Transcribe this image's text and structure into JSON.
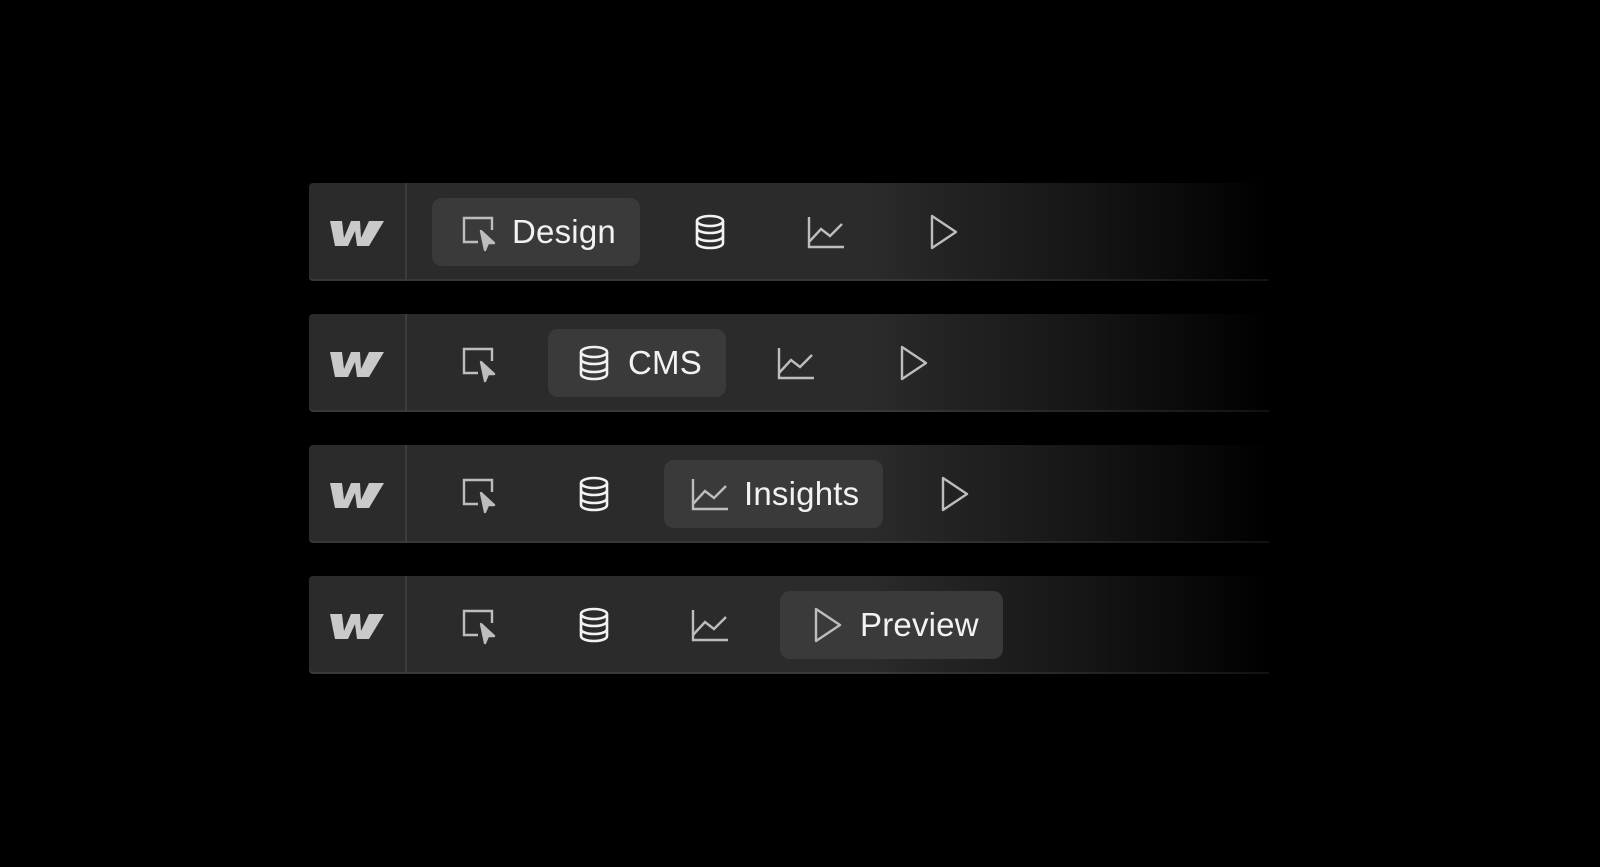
{
  "colors": {
    "background": "#000000",
    "bar": "#2b2b2b",
    "active_item": "#3a3a3a",
    "text": "#f2f2f2",
    "icon": "#bdbdbd"
  },
  "bars": [
    {
      "active": "design",
      "items": [
        {
          "key": "design",
          "icon": "cursor-select-icon",
          "label": "Design"
        },
        {
          "key": "cms",
          "icon": "database-icon",
          "label": ""
        },
        {
          "key": "insights",
          "icon": "line-chart-icon",
          "label": ""
        },
        {
          "key": "preview",
          "icon": "play-icon",
          "label": ""
        }
      ]
    },
    {
      "active": "cms",
      "items": [
        {
          "key": "design",
          "icon": "cursor-select-icon",
          "label": ""
        },
        {
          "key": "cms",
          "icon": "database-icon",
          "label": "CMS"
        },
        {
          "key": "insights",
          "icon": "line-chart-icon",
          "label": ""
        },
        {
          "key": "preview",
          "icon": "play-icon",
          "label": ""
        }
      ]
    },
    {
      "active": "insights",
      "items": [
        {
          "key": "design",
          "icon": "cursor-select-icon",
          "label": ""
        },
        {
          "key": "cms",
          "icon": "database-icon",
          "label": ""
        },
        {
          "key": "insights",
          "icon": "line-chart-icon",
          "label": "Insights"
        },
        {
          "key": "preview",
          "icon": "play-icon",
          "label": ""
        }
      ]
    },
    {
      "active": "preview",
      "items": [
        {
          "key": "design",
          "icon": "cursor-select-icon",
          "label": ""
        },
        {
          "key": "cms",
          "icon": "database-icon",
          "label": ""
        },
        {
          "key": "insights",
          "icon": "line-chart-icon",
          "label": ""
        },
        {
          "key": "preview",
          "icon": "play-icon",
          "label": "Preview"
        }
      ]
    }
  ],
  "logo": {
    "icon": "webflow-logo-icon"
  }
}
